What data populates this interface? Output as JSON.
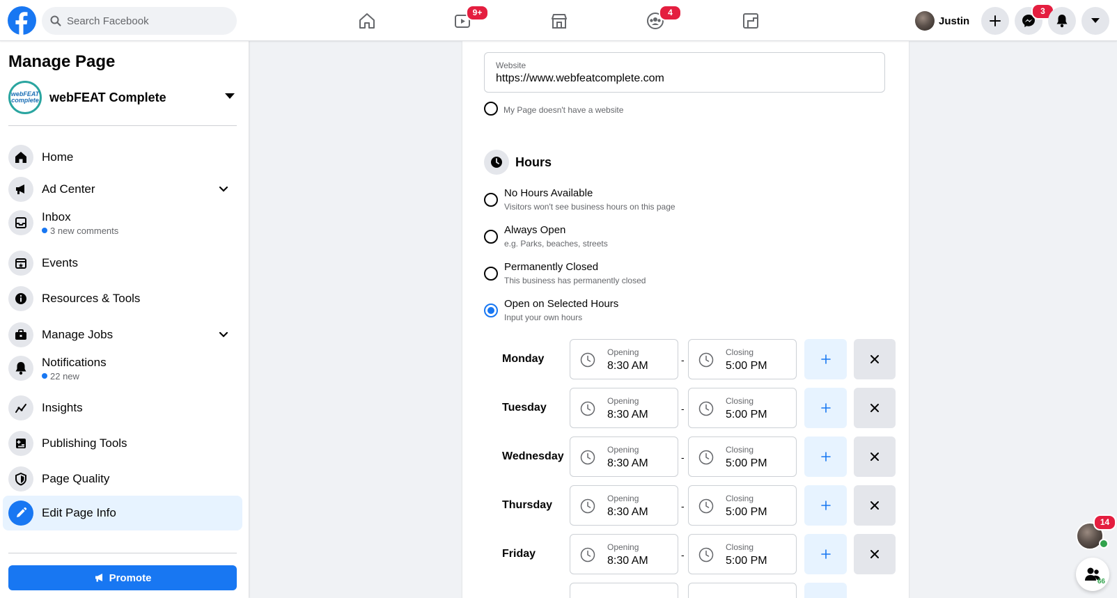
{
  "topbar": {
    "search_placeholder": "Search Facebook",
    "watch_badge": "9+",
    "groups_badge": "4",
    "profile_name": "Justin",
    "messenger_badge": "3"
  },
  "sidebar": {
    "title": "Manage Page",
    "page_name": "webFEAT Complete",
    "page_logo_text": "webFEAT complete",
    "items": [
      {
        "label": "Home",
        "icon": "home-icon"
      },
      {
        "label": "Ad Center",
        "icon": "megaphone-icon"
      },
      {
        "label": "Inbox",
        "sub": "3 new comments",
        "icon": "inbox-icon"
      },
      {
        "label": "Events",
        "icon": "calendar-star-icon"
      },
      {
        "label": "Resources & Tools",
        "icon": "info-icon"
      },
      {
        "label": "Manage Jobs",
        "icon": "briefcase-icon"
      },
      {
        "label": "Notifications",
        "sub": "22 new",
        "icon": "bell-icon"
      },
      {
        "label": "Insights",
        "icon": "insights-icon"
      },
      {
        "label": "Publishing Tools",
        "icon": "publishing-icon"
      },
      {
        "label": "Page Quality",
        "icon": "shield-icon"
      },
      {
        "label": "Edit Page Info",
        "icon": "pencil-icon"
      }
    ],
    "promote_label": "Promote"
  },
  "main": {
    "website_label": "Website",
    "website_value": "https://www.webfeatcomplete.com",
    "no_website_label": "My Page doesn't have a website",
    "hours_title": "Hours",
    "options": [
      {
        "title": "No Hours Available",
        "desc": "Visitors won't see business hours on this page"
      },
      {
        "title": "Always Open",
        "desc": "e.g. Parks, beaches, streets"
      },
      {
        "title": "Permanently Closed",
        "desc": "This business has permanently closed"
      },
      {
        "title": "Open on Selected Hours",
        "desc": "Input your own hours"
      }
    ],
    "selected_option": "Open on Selected Hours",
    "opening_label": "Opening",
    "closing_label": "Closing",
    "separator": "-",
    "days": [
      {
        "day": "Monday",
        "open": "8:30 AM",
        "close": "5:00 PM"
      },
      {
        "day": "Tuesday",
        "open": "8:30 AM",
        "close": "5:00 PM"
      },
      {
        "day": "Wednesday",
        "open": "8:30 AM",
        "close": "5:00 PM"
      },
      {
        "day": "Thursday",
        "open": "8:30 AM",
        "close": "5:00 PM"
      },
      {
        "day": "Friday",
        "open": "8:30 AM",
        "close": "5:00 PM"
      }
    ]
  },
  "chat": {
    "unread_badge": "14",
    "contacts_count": "66"
  },
  "colors": {
    "brand": "#1877f2",
    "badge": "#e41e3f",
    "online": "#31a24c"
  }
}
